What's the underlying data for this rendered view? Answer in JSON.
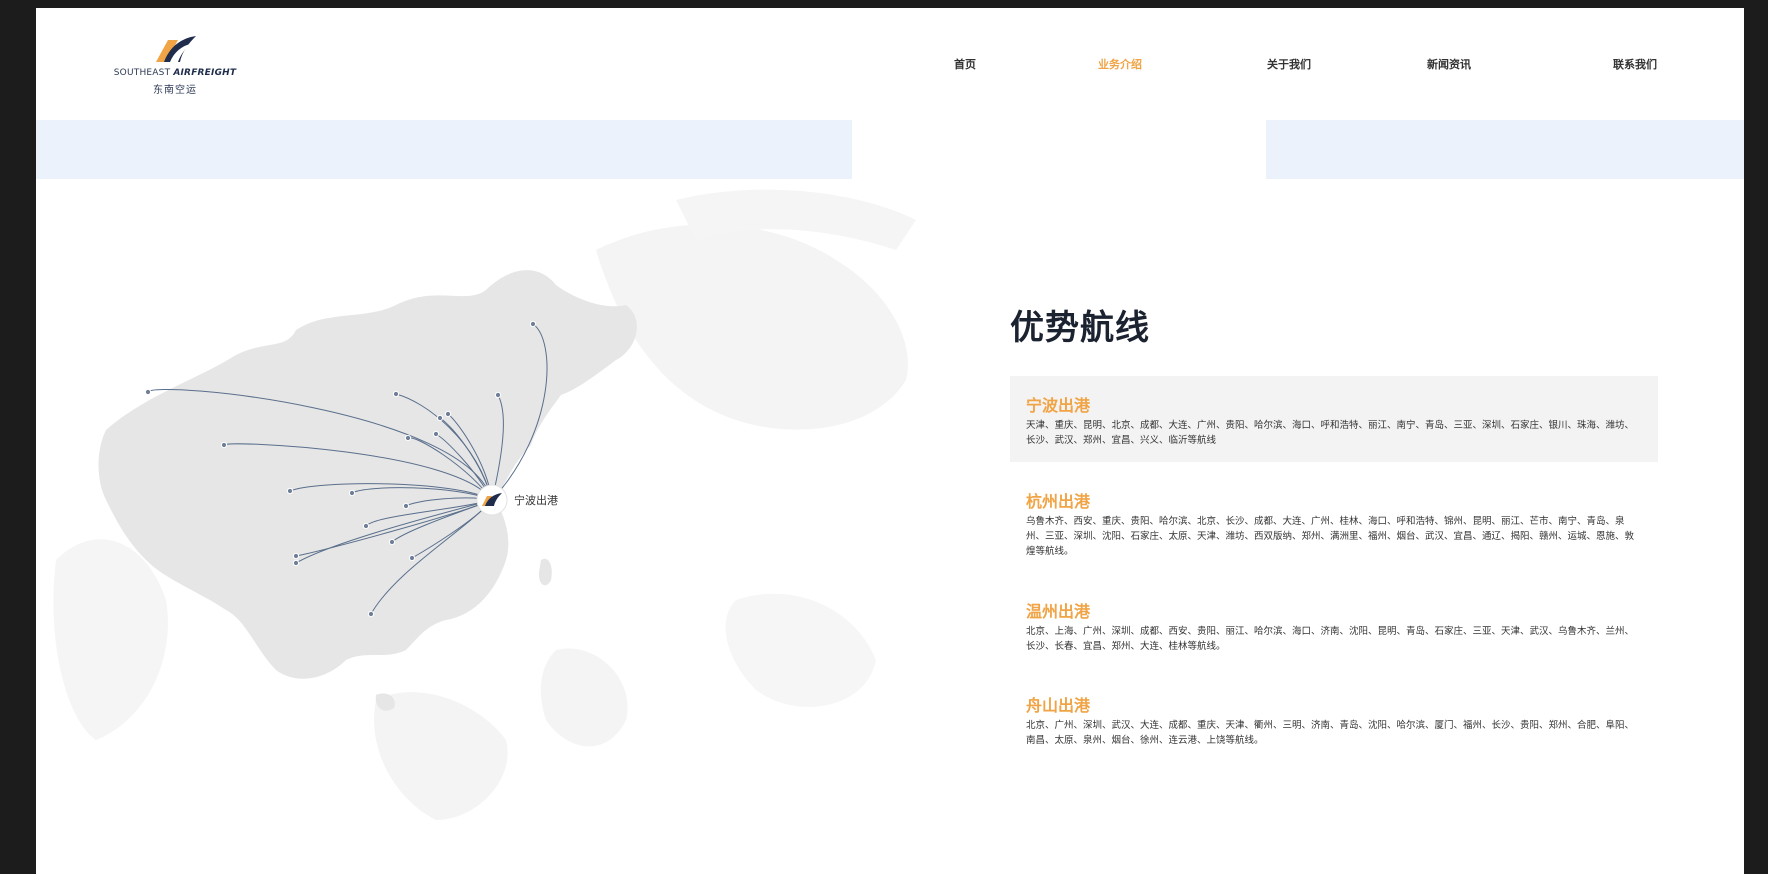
{
  "logo": {
    "en_prefix": "SOUTHEAST ",
    "en_suffix": "AIRFREIGHT",
    "cn": "东南空运"
  },
  "nav": {
    "items": [
      {
        "label": "首页",
        "active": false
      },
      {
        "label": "业务介绍",
        "active": true
      },
      {
        "label": "关于我们",
        "active": false
      },
      {
        "label": "新闻资讯",
        "active": false
      },
      {
        "label": "联系我们",
        "active": false
      }
    ],
    "active_color": "#f0a445"
  },
  "map": {
    "origin_label": "宁波出港",
    "marker_icon": "airfreight-logo-icon"
  },
  "content": {
    "title": "优势航线",
    "sections": [
      {
        "title": "宁波出港",
        "text": "天津、重庆、昆明、北京、成都、大连、广州、贵阳、哈尔滨、海口、呼和浩特、丽江、南宁、青岛、三亚、深圳、石家庄、银川、珠海、潍坊、长沙、武汉、郑州、宜昌、兴义、临沂等航线"
      },
      {
        "title": "杭州出港",
        "text": "乌鲁木齐、西安、重庆、贵阳、哈尔滨、北京、长沙、成都、大连、广州、桂林、海口、呼和浩特、锦州、昆明、丽江、芒市、南宁、青岛、泉州、三亚、深圳、沈阳、石家庄、太原、天津、潍坊、西双版纳、郑州、满洲里、福州、烟台、武汉、宜昌、通辽、揭阳、赣州、运城、恩施、敦煌等航线。"
      },
      {
        "title": "温州出港",
        "text": "北京、上海、广州、深圳、成都、西安、贵阳、丽江、哈尔滨、海口、济南、沈阳、昆明、青岛、石家庄、三亚、天津、武汉、乌鲁木齐、兰州、长沙、长春、宜昌、郑州、大连、桂林等航线。"
      },
      {
        "title": "舟山出港",
        "text": "北京、广州、深圳、武汉、大连、成都、重庆、天津、衢州、三明、济南、青岛、沈阳、哈尔滨、厦门、福州、长沙、贵阳、郑州、合肥、阜阳、南昌、太原、泉州、烟台、徐州、连云港、上饶等航线。"
      }
    ]
  },
  "colors": {
    "accent": "#f0a445",
    "band": "#ecf2fc",
    "route_line": "#5a6f8c",
    "land": "#e6e6e6"
  }
}
